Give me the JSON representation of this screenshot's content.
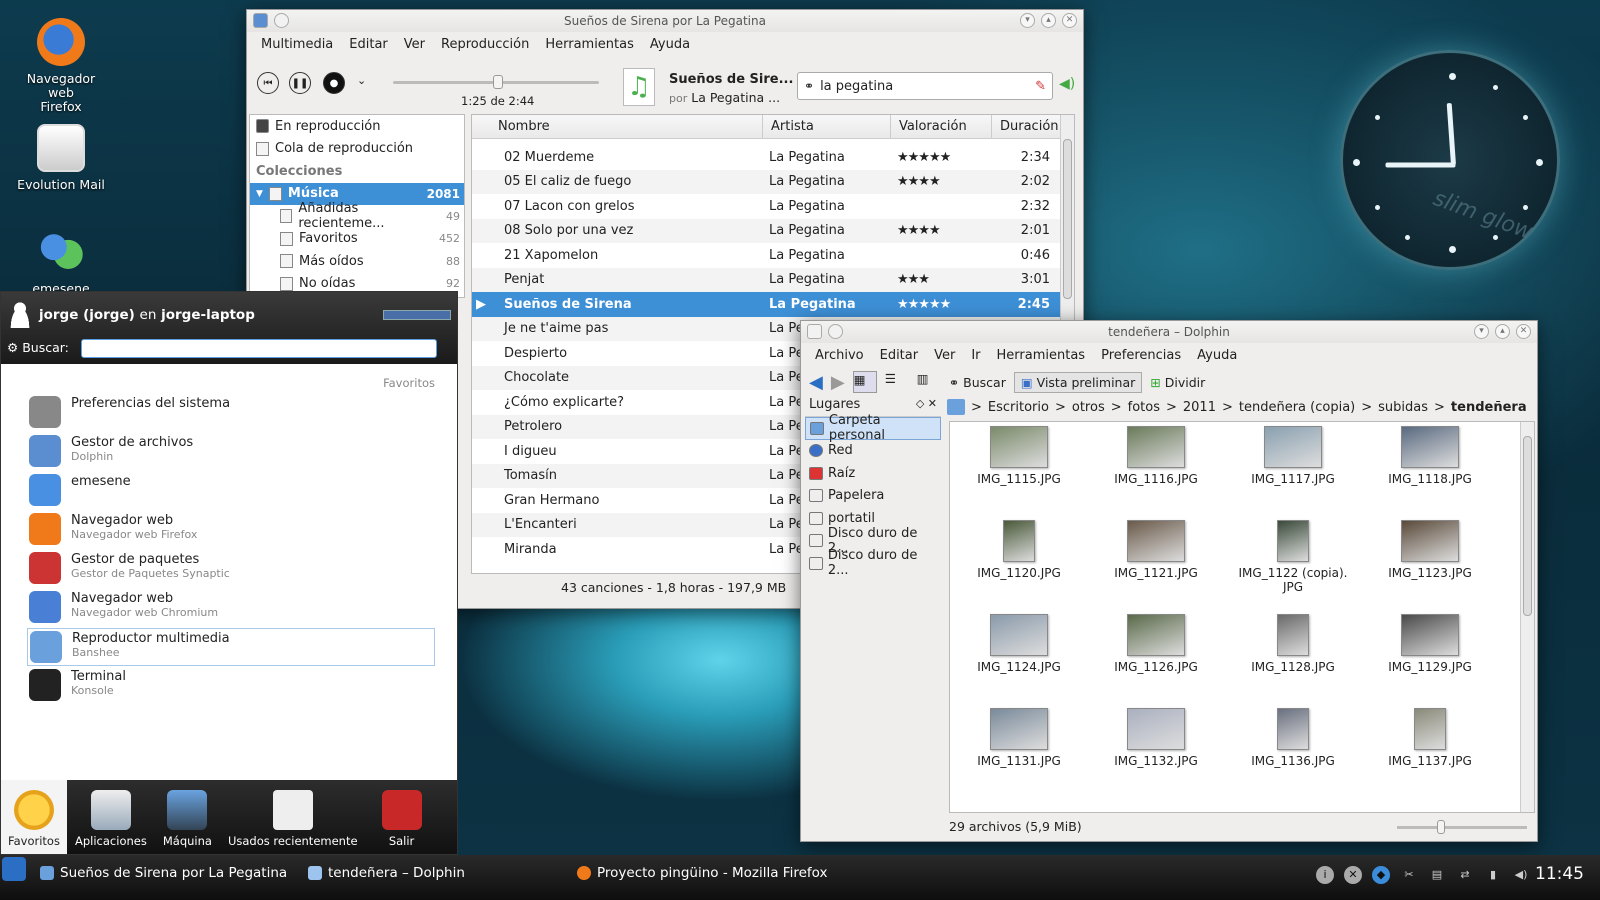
{
  "desktop": {
    "icons": [
      {
        "label": "Navegador web Firefox"
      },
      {
        "label": "Evolution Mail"
      },
      {
        "label": "emesene"
      }
    ],
    "clock_brand": "slim glow"
  },
  "banshee": {
    "title": "Sueños de Sirena por La Pegatina",
    "menu": [
      "Multimedia",
      "Editar",
      "Ver",
      "Reproducción",
      "Herramientas",
      "Ayuda"
    ],
    "time": "1:25 de 2:44",
    "now_playing": {
      "track": "Sueños de Sire...",
      "by": "por",
      "artist": "La Pegatina ..."
    },
    "search": "la pegatina",
    "sources": {
      "now": "En reproducción",
      "queue": "Cola de reproducción",
      "collections": "Colecciones",
      "music": "Música",
      "music_count": "2081",
      "sub": [
        {
          "label": "Añadidas recienteme...",
          "count": "49"
        },
        {
          "label": "Favoritos",
          "count": "452"
        },
        {
          "label": "Más oídos",
          "count": "88"
        },
        {
          "label": "No oídas",
          "count": "92"
        }
      ]
    },
    "columns": [
      "Nombre",
      "Artista",
      "Valoración",
      "Duración"
    ],
    "tracks": [
      {
        "name": "02 Muerdeme",
        "artist": "La Pegatina",
        "rating": "★★★★★",
        "dur": "2:34"
      },
      {
        "name": "05 El caliz de fuego",
        "artist": "La Pegatina",
        "rating": "★★★★",
        "dur": "2:02"
      },
      {
        "name": "07 Lacon con grelos",
        "artist": "La Pegatina",
        "rating": "",
        "dur": "2:32"
      },
      {
        "name": "08 Solo por una vez",
        "artist": "La Pegatina",
        "rating": "★★★★",
        "dur": "2:01"
      },
      {
        "name": "21 Xapomelon",
        "artist": "La Pegatina",
        "rating": "",
        "dur": "0:46"
      },
      {
        "name": "Penjat",
        "artist": "La Pegatina",
        "rating": "★★★",
        "dur": "3:01"
      },
      {
        "name": "Sueños de Sirena",
        "artist": "La Pegatina",
        "rating": "★★★★★",
        "dur": "2:45"
      },
      {
        "name": "Je ne t'aime pas",
        "artist": "La Pe",
        "rating": "",
        "dur": ""
      },
      {
        "name": "Despierto",
        "artist": "La Pe",
        "rating": "",
        "dur": ""
      },
      {
        "name": "Chocolate",
        "artist": "La Pe",
        "rating": "",
        "dur": ""
      },
      {
        "name": "¿Cómo explicarte?",
        "artist": "La Pe",
        "rating": "",
        "dur": ""
      },
      {
        "name": "Petrolero",
        "artist": "La Pe",
        "rating": "",
        "dur": ""
      },
      {
        "name": "I digueu",
        "artist": "La Pe",
        "rating": "",
        "dur": ""
      },
      {
        "name": "Tomasín",
        "artist": "La Pe",
        "rating": "",
        "dur": ""
      },
      {
        "name": "Gran Hermano",
        "artist": "La Pe",
        "rating": "",
        "dur": ""
      },
      {
        "name": "L'Encanteri",
        "artist": "La Pe",
        "rating": "",
        "dur": ""
      },
      {
        "name": "Miranda",
        "artist": "La Pe",
        "rating": "",
        "dur": ""
      }
    ],
    "status": "43 canciones - 1,8 horas - 197,9 MB"
  },
  "dolphin": {
    "title": "tendeñera – Dolphin",
    "menu": [
      "Archivo",
      "Editar",
      "Ver",
      "Ir",
      "Herramientas",
      "Preferencias",
      "Ayuda"
    ],
    "toolbar": {
      "search": "Buscar",
      "preview": "Vista preliminar",
      "split": "Dividir"
    },
    "places_title": "Lugares",
    "places": [
      "Carpeta personal",
      "Red",
      "Raíz",
      "Papelera",
      "portatil",
      "Disco duro de 2...",
      "Disco duro de 2..."
    ],
    "breadcrumb": [
      "Escritorio",
      "otros",
      "fotos",
      "2011",
      "tendeñera (copia)",
      "subidas",
      "tendeñera"
    ],
    "files": [
      "IMG_1115.JPG",
      "IMG_1116.JPG",
      "IMG_1117.JPG",
      "IMG_1118.JPG",
      "IMG_1120.JPG",
      "IMG_1121.JPG",
      "IMG_1122 (copia).\nJPG",
      "IMG_1123.JPG",
      "IMG_1124.JPG",
      "IMG_1126.JPG",
      "IMG_1128.JPG",
      "IMG_1129.JPG",
      "IMG_1131.JPG",
      "IMG_1132.JPG",
      "IMG_1136.JPG",
      "IMG_1137.JPG"
    ],
    "status": "29 archivos (5,9 MiB)"
  },
  "kickoff": {
    "user": "jorge (jorge)",
    "en": "en",
    "host": "jorge-laptop",
    "search_label": "Buscar:",
    "section": "Favoritos",
    "favorites": [
      {
        "t1": "Preferencias del sistema",
        "t2": ""
      },
      {
        "t1": "Gestor de archivos",
        "t2": "Dolphin"
      },
      {
        "t1": "emesene",
        "t2": ""
      },
      {
        "t1": "Navegador web",
        "t2": "Navegador web Firefox"
      },
      {
        "t1": "Gestor de paquetes",
        "t2": "Gestor de Paquetes Synaptic"
      },
      {
        "t1": "Navegador web",
        "t2": "Navegador web Chromium"
      },
      {
        "t1": "Reproductor multimedia",
        "t2": "Banshee"
      },
      {
        "t1": "Terminal",
        "t2": "Konsole"
      }
    ],
    "tabs": [
      "Favoritos",
      "Aplicaciones",
      "Máquina",
      "Usados recientemente",
      "Salir"
    ]
  },
  "taskbar": {
    "tasks": [
      "Sueños de Sirena por La Pegatina",
      "tendeñera – Dolphin",
      "Proyecto pingüino - Mozilla Firefox"
    ],
    "time": "11:45"
  }
}
